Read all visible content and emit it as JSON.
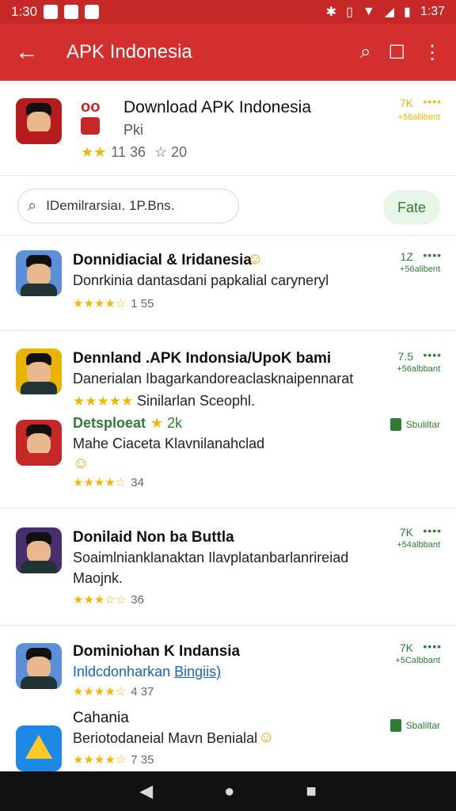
{
  "status_bar": {
    "time_left": "1:30",
    "time_right": "1:37"
  },
  "app_bar": {
    "title": "APK Indonesia"
  },
  "featured": {
    "title": "Download APK Indonesia",
    "sub": "Pki",
    "rating_count": "11 36",
    "star_extra": "☆ 20",
    "green_top": "7K",
    "green_bottom": "+56allibent"
  },
  "search": {
    "placeholder": "IDemilrarsiaı. 1P.Bns.",
    "filter_label": "Fate"
  },
  "sections": [
    {
      "title": "Donnidiacial & Iridanesia",
      "line2": "Donrkinia dantasdani papkalial caryneryl",
      "rating": "1  55",
      "green_top": "1Z",
      "green_bottom": "+56alibent"
    },
    {
      "title": "Dennland .APK Indonsia/UpoK bami",
      "line2": "Danerialan Ibagarkandoreaclasknaipennarat",
      "line3": "Sinilarlan Sceophl.",
      "sub_label": "Detsploeat",
      "sub_rating": "2k",
      "line4": "Mahe Ciaceta Klavnilanahclad",
      "rating": "34",
      "green_top": "7.5",
      "green_bottom": "+56albbant",
      "badge": "Sbuliltar"
    },
    {
      "title": "Donilaid Non ba Buttla",
      "line2": "Soaimlnianklanaktan Ilavplatanbarlanrireiad",
      "line3": "Maojnk.",
      "rating": "36",
      "green_top": "7K",
      "green_bottom": "+54albbant"
    },
    {
      "title": "Dominiohan K Indansia",
      "line2": "Inldcdonharkan",
      "line2_link": "Bingiis)",
      "rating": "4  37",
      "green_top": "7K",
      "green_bottom": "+5Calbbant",
      "app2_title": "Cahania",
      "app2_line": "Beriotodaneial Mavn Benialal",
      "app2_rating": "7  35",
      "badge": "Sbaliltar"
    }
  ]
}
